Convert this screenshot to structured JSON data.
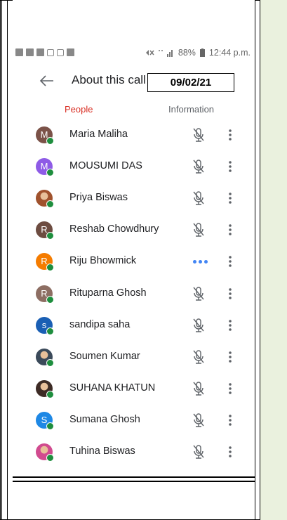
{
  "status_bar": {
    "left_icons": [
      "notification-icon",
      "notification-icon",
      "notification-icon",
      "message-icon",
      "calendar-icon",
      "app-icon"
    ],
    "battery": "88%",
    "time": "12:44 p.m."
  },
  "header": {
    "title": "About this call",
    "date": "09/02/21"
  },
  "tabs": [
    {
      "label": "People",
      "active": true
    },
    {
      "label": "Information",
      "active": false
    }
  ],
  "participants": [
    {
      "name": "Maria Maliha",
      "initial": "M",
      "color": "#7b5248",
      "status": "muted"
    },
    {
      "name": "MOUSUMI DAS",
      "initial": "M",
      "color": "#8e5be6",
      "status": "muted"
    },
    {
      "name": "Priya Biswas",
      "initial": "",
      "color": "#a0522d",
      "status": "muted",
      "photo": true
    },
    {
      "name": "Reshab Chowdhury",
      "initial": "R",
      "color": "#6d4c41",
      "status": "muted"
    },
    {
      "name": "Riju Bhowmick",
      "initial": "R",
      "color": "#f57c00",
      "status": "speaking"
    },
    {
      "name": "Rituparna Ghosh",
      "initial": "R",
      "color": "#8d6e63",
      "status": "muted"
    },
    {
      "name": "sandipa saha",
      "initial": "s",
      "color": "#1a5fb4",
      "status": "muted"
    },
    {
      "name": "Soumen Kumar",
      "initial": "",
      "color": "#3b4a5a",
      "status": "muted",
      "photo": true
    },
    {
      "name": "SUHANA KHATUN",
      "initial": "",
      "color": "#3d2b25",
      "status": "muted",
      "photo": true
    },
    {
      "name": "Sumana Ghosh",
      "initial": "S",
      "color": "#1e88e5",
      "status": "muted"
    },
    {
      "name": "Tuhina Biswas",
      "initial": "",
      "color": "#d14b8f",
      "status": "muted",
      "photo": true
    }
  ],
  "colors": {
    "accent_tab": "#d93025",
    "online_dot": "#1e8e3e",
    "speaking_dots": "#4285f4",
    "side_panel": "#eaf1de"
  }
}
